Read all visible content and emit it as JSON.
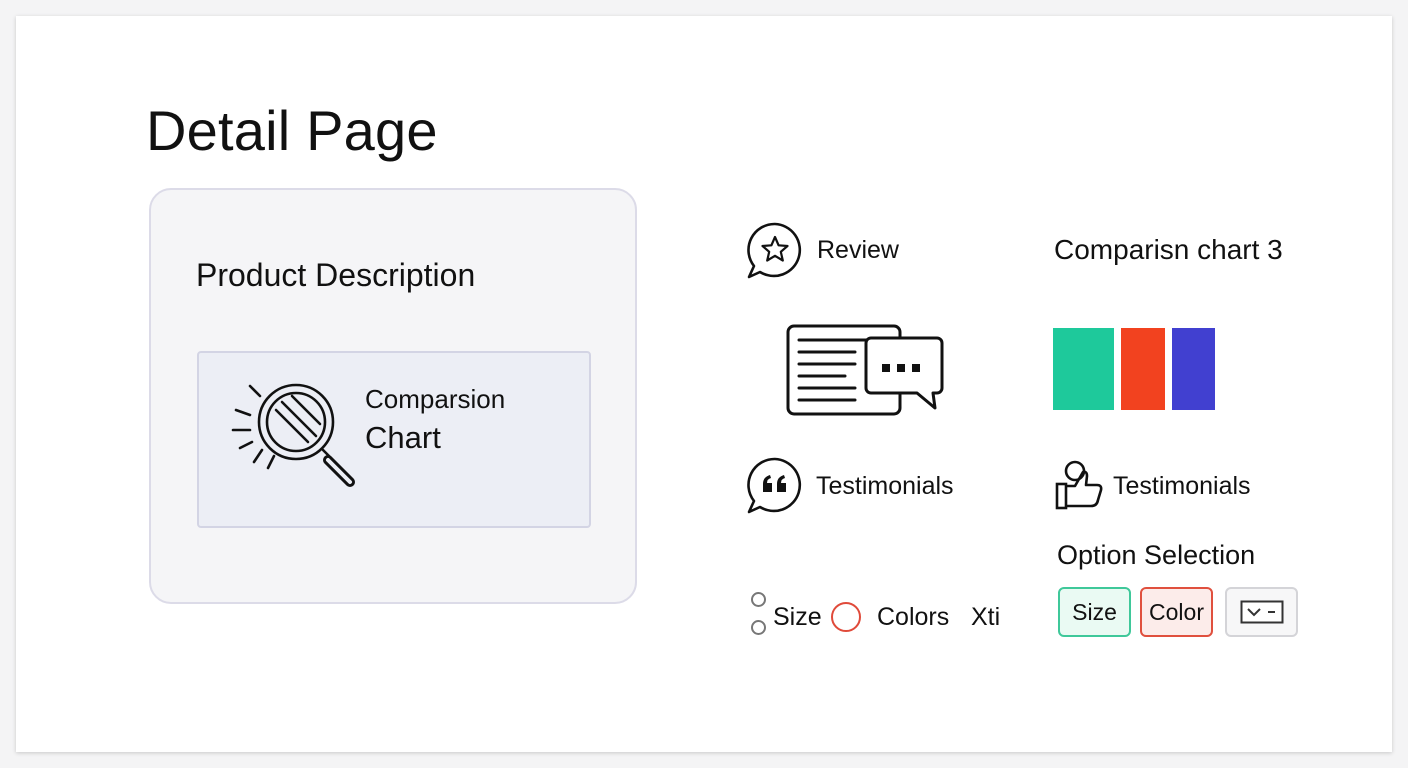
{
  "page": {
    "title": "Detail Page"
  },
  "product": {
    "title": "Product Description",
    "chart_label_line1": "Comparsion",
    "chart_label_line2": "Chart",
    "icon": "magnifier-sparkle-icon"
  },
  "review": {
    "label": "Review",
    "icon": "star-speech-bubble-icon",
    "illustration": "document-chat-bubble-icon"
  },
  "comparison": {
    "title": "Comparisn chart 3",
    "colors": [
      "#1ec99b",
      "#f2421f",
      "#4140d0"
    ]
  },
  "testimonials": [
    {
      "label": "Testimonials",
      "icon": "quote-speech-bubble-icon"
    },
    {
      "label": "Testimonials",
      "icon": "person-thumbs-up-icon"
    }
  ],
  "radio_options": {
    "size_label": "Size",
    "colors_label": "Colors",
    "extra_label": "Xti",
    "accent": "#e04a3a"
  },
  "option_selection": {
    "title": "Option Selection",
    "chips": [
      {
        "label": "Size",
        "accent": "#3fc89a"
      },
      {
        "label": "Color",
        "accent": "#e0503e"
      }
    ],
    "dropdown_icon": "dropdown-chevron-icon"
  }
}
